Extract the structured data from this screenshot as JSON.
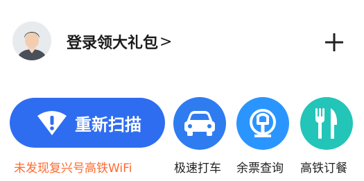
{
  "header": {
    "login_label": "登录领大礼包",
    "chevron": ">",
    "add_icon": "plus-icon"
  },
  "rescan": {
    "label": "重新扫描",
    "icon": "wifi-warning-icon",
    "color": "#2f6df0"
  },
  "warning": {
    "text": "未发现复兴号高铁WiFi",
    "color": "#ff6a2f"
  },
  "tiles": [
    {
      "label": "极速打车",
      "icon": "car-icon",
      "color": "#2f7cf0"
    },
    {
      "label": "余票查询",
      "icon": "train-logo-icon",
      "color": "#2b95ff"
    },
    {
      "label": "高铁订餐",
      "icon": "fork-knife-icon",
      "color": "#22c5b8"
    }
  ]
}
